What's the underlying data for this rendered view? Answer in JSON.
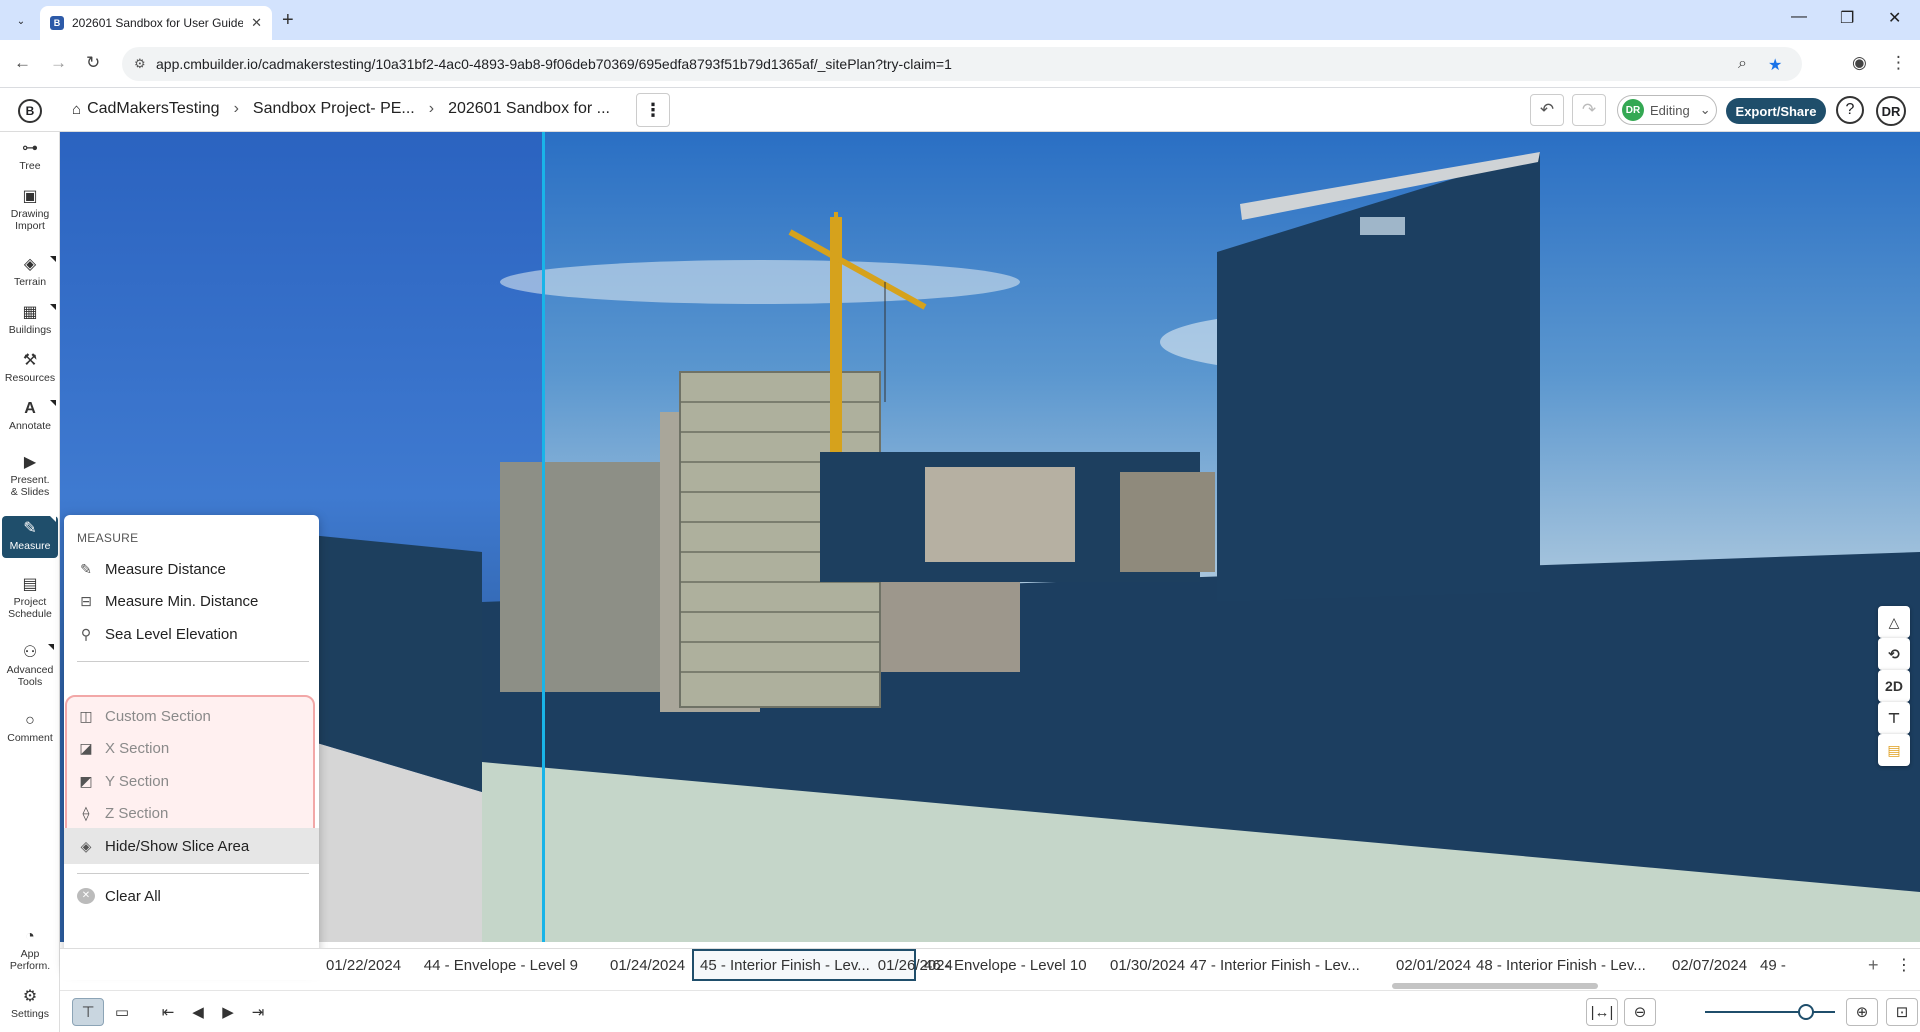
{
  "browser": {
    "tab_title": "202601 Sandbox for User Guide",
    "url": "app.cmbuilder.io/cadmakerstesting/10a31bf2-4ac0-4893-9ab8-9f06deb70369/695edfa8793f51b79d1365af/_sitePlan?try-claim=1"
  },
  "header": {
    "logo": "B",
    "breadcrumbs": [
      "CadMakersTesting",
      "Sandbox Project- PE...",
      "202601 Sandbox for ..."
    ],
    "mode_initials": "DR",
    "mode_label": "Editing",
    "export_label": "Export/Share",
    "help_label": "?",
    "user_initials": "DR"
  },
  "sidebar": {
    "items": [
      {
        "label": "Tree",
        "icon": "tree-icon"
      },
      {
        "label": "Drawing Import",
        "icon": "image-icon"
      },
      {
        "label": "Terrain",
        "icon": "layers-icon"
      },
      {
        "label": "Buildings",
        "icon": "building-icon"
      },
      {
        "label": "Resources",
        "icon": "crane-icon"
      },
      {
        "label": "Annotate",
        "icon": "text-icon"
      },
      {
        "label": "Present. & Slides",
        "icon": "presentation-icon"
      },
      {
        "label": "Measure",
        "icon": "ruler-icon"
      },
      {
        "label": "Project Schedule",
        "icon": "calendar-icon"
      },
      {
        "label": "Advanced Tools",
        "icon": "tools-icon"
      },
      {
        "label": "Comment",
        "icon": "comment-icon"
      },
      {
        "label": "App Perform.",
        "icon": "speedometer-icon"
      },
      {
        "label": "Settings",
        "icon": "gear-icon"
      }
    ]
  },
  "measure_menu": {
    "header": "MEASURE",
    "items": [
      {
        "label": "Measure Distance",
        "enabled": true
      },
      {
        "label": "Measure Min. Distance",
        "enabled": true
      },
      {
        "label": "Sea Level Elevation",
        "enabled": true
      },
      {
        "label": "Custom Section",
        "enabled": false
      },
      {
        "label": "X Section",
        "enabled": false
      },
      {
        "label": "Y Section",
        "enabled": false
      },
      {
        "label": "Z Section",
        "enabled": false
      },
      {
        "label": "Hide/Show Slice Area",
        "enabled": true
      },
      {
        "label": "Clear All",
        "enabled": true
      }
    ]
  },
  "right_tools": {
    "view2d_label": "2D"
  },
  "schedule": {
    "dates": [
      "01/22/2024",
      "01/24/2024",
      "01/26/2024",
      "01/30/2024",
      "02/01/2024",
      "02/07/2024"
    ],
    "tasks": [
      {
        "label": "44 - Envelope - Level 9"
      },
      {
        "label": "45 - Interior Finish - Lev..."
      },
      {
        "label": "46 - Envelope - Level 10"
      },
      {
        "label": "47 - Interior Finish - Lev..."
      },
      {
        "label": "48 - Interior Finish - Lev..."
      },
      {
        "label": "49 -"
      }
    ],
    "selected_index": 1,
    "zoom_level": 0.78
  },
  "colors": {
    "accent": "#1f4e6b",
    "slice_line": "#19b4e8",
    "section_highlight": "#f2a7a7"
  }
}
